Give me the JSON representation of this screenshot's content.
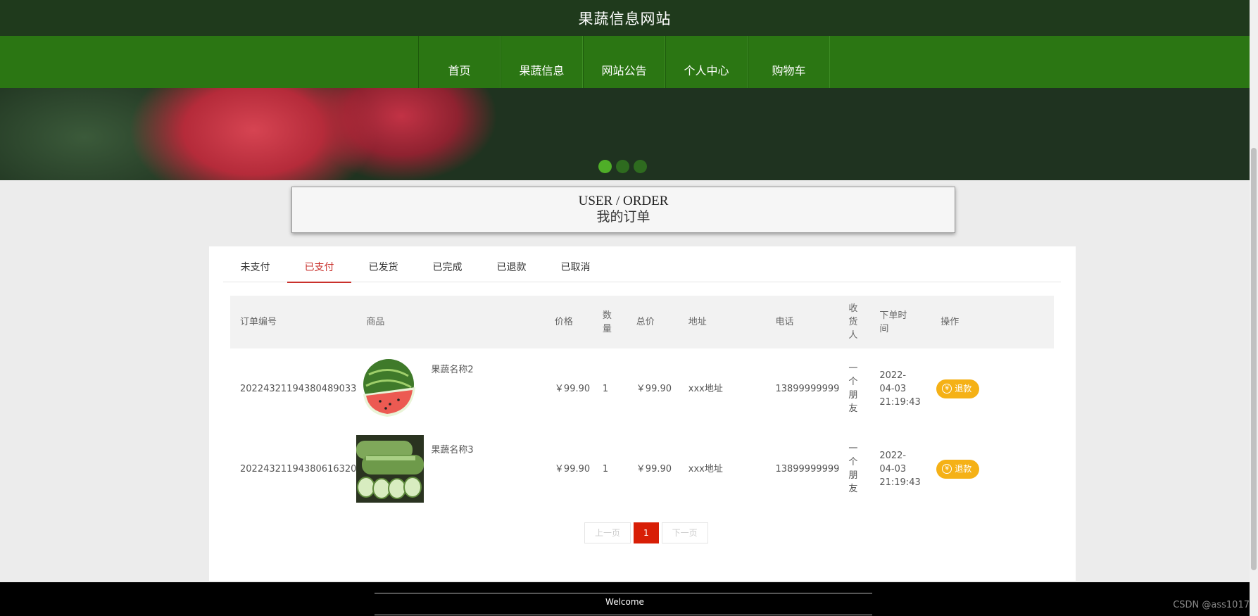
{
  "header": {
    "site_title": "果蔬信息网站"
  },
  "nav": {
    "items": [
      "首页",
      "果蔬信息",
      "网站公告",
      "个人中心",
      "购物车"
    ]
  },
  "section_title": {
    "en": "USER / ORDER",
    "cn": "我的订单"
  },
  "tabs": {
    "items": [
      "未支付",
      "已支付",
      "已发货",
      "已完成",
      "已退款",
      "已取消"
    ],
    "active_index": 1
  },
  "orders_table": {
    "headers": {
      "order_no": "订单编号",
      "product": "商品",
      "price": "价格",
      "quantity": "数\n量",
      "total": "总价",
      "address": "地址",
      "phone": "电话",
      "receiver": "收\n货\n人",
      "order_time": "下单时\n间",
      "action": "操作"
    },
    "rows": [
      {
        "order_no": "20224321194380489033",
        "product_name": "果蔬名称2",
        "product_image": "watermelon",
        "price": "￥99.90",
        "quantity": "1",
        "total": "￥99.90",
        "address": "xxx地址",
        "phone": "13899999999",
        "receiver": "一\n个\n朋\n友",
        "order_time": "2022-\n04-03\n21:19:43",
        "action_label": "退款"
      },
      {
        "order_no": "20224321194380616320",
        "product_name": "果蔬名称3",
        "product_image": "winter-melon",
        "price": "￥99.90",
        "quantity": "1",
        "total": "￥99.90",
        "address": "xxx地址",
        "phone": "13899999999",
        "receiver": "一\n个\n朋\n友",
        "order_time": "2022-\n04-03\n21:19:43",
        "action_label": "退款"
      }
    ]
  },
  "pagination": {
    "prev": "上一页",
    "current": "1",
    "next": "下一页"
  },
  "footer": {
    "text": "Welcome"
  },
  "watermark": "CSDN @ass1017",
  "colors": {
    "nav_green": "#2b7613",
    "topbar": "#1f3a1c",
    "accent_red": "#d81e06",
    "refund_orange": "#f5b116"
  }
}
